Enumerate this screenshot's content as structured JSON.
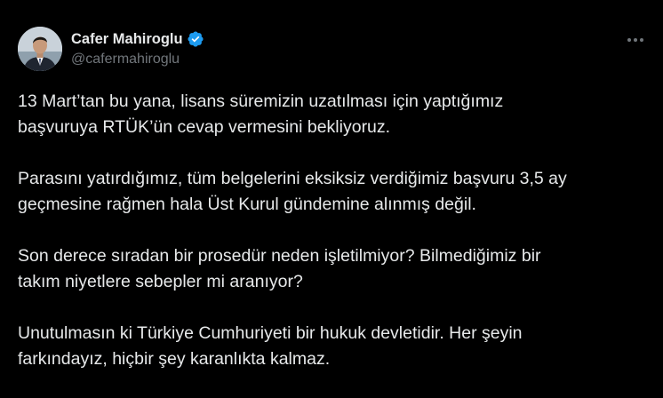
{
  "author": {
    "display_name": "Cafer Mahiroglu",
    "handle": "@cafermahiroglu",
    "verified": true,
    "verified_color": "#1d9bf0"
  },
  "icons": {
    "verified": "verified-badge-icon",
    "more": "more-horizontal-icon"
  },
  "tweet": {
    "paragraphs": [
      {
        "lines": [
          "13 Mart’tan bu yana, lisans süremizin uzatılması için yaptığımız",
          "başvuruya RTÜK’ün cevap vermesini bekliyoruz."
        ]
      },
      {
        "lines": [
          "Parasını yatırdığımız, tüm belgelerini eksiksiz verdiğimiz başvuru 3,5 ay",
          "geçmesine rağmen hala Üst Kurul gündemine alınmış değil."
        ]
      },
      {
        "lines": [
          "Son derece sıradan bir prosedür neden işletilmiyor? Bilmediğimiz bir",
          "takım niyetlere sebepler mi aranıyor?"
        ]
      },
      {
        "lines": [
          "Unutulmasın ki Türkiye Cumhuriyeti bir hukuk devletidir. Her şeyin",
          "farkındayız, hiçbir şey karanlıkta kalmaz."
        ]
      }
    ]
  }
}
